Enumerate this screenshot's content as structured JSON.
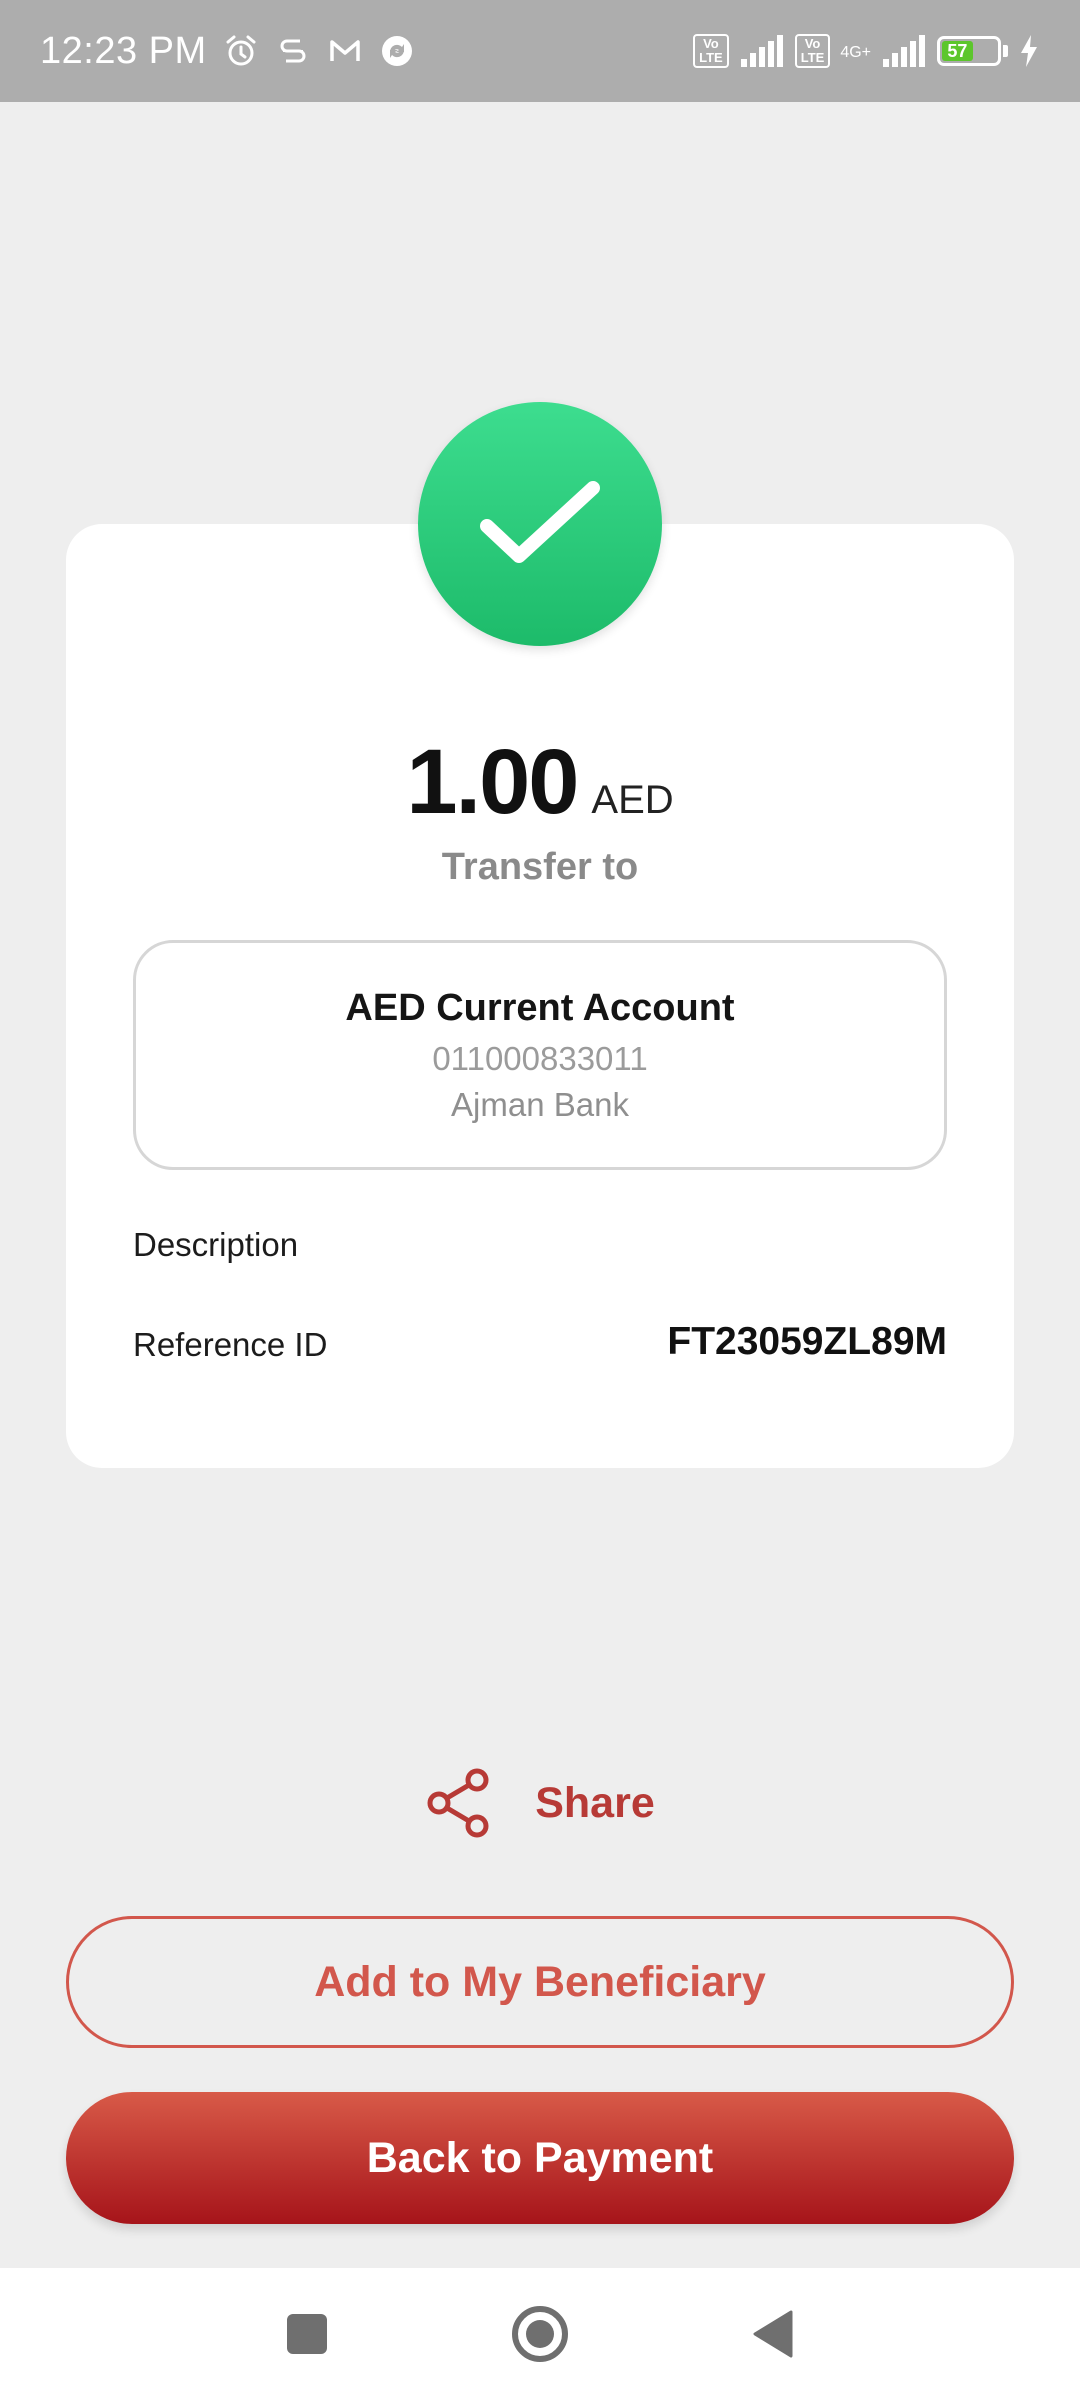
{
  "status_bar": {
    "time": "12:23 PM",
    "icons": [
      "alarm-icon",
      "s-app-icon",
      "gmail-icon",
      "sync-app-icon"
    ],
    "volte_label": "Vo\nLTE",
    "network_label": "4G+",
    "battery_level": "57",
    "battery_fraction": 0.57,
    "charging": true
  },
  "result": {
    "status_icon": "check-icon",
    "amount": "1.00",
    "currency": "AED",
    "transfer_label": "Transfer to"
  },
  "account": {
    "name": "AED Current Account",
    "number": "011000833011",
    "bank": "Ajman Bank"
  },
  "details": {
    "description_label": "Description",
    "description_value": "",
    "reference_label": "Reference ID",
    "reference_value": "FT23059ZL89M"
  },
  "actions": {
    "share_label": "Share",
    "add_beneficiary_label": "Add to My Beneficiary",
    "back_label": "Back to Payment"
  },
  "nav": {
    "icons": [
      "recents-square-icon",
      "home-circle-icon",
      "back-triangle-icon"
    ]
  },
  "colors": {
    "accent": "#b73a36",
    "accent_outline": "#d2574c",
    "success": "#22c576",
    "primary_gradient_top": "#d85a48",
    "primary_gradient_bottom": "#a6141a",
    "background": "#eeeeee",
    "status_bar": "#adadad"
  }
}
